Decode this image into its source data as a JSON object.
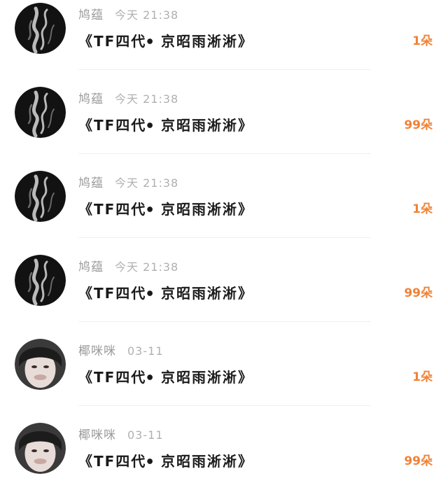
{
  "records": [
    {
      "user": "鸠蕴",
      "time": "今天 21:38",
      "message": "《TF四代ꔷ 京昭雨淅淅》",
      "gift": "1朵",
      "avatar": "smoke-avatar"
    },
    {
      "user": "鸠蕴",
      "time": "今天 21:38",
      "message": "《TF四代ꔷ 京昭雨淅淅》",
      "gift": "99朵",
      "avatar": "smoke-avatar"
    },
    {
      "user": "鸠蕴",
      "time": "今天 21:38",
      "message": "《TF四代ꔷ 京昭雨淅淅》",
      "gift": "1朵",
      "avatar": "smoke-avatar"
    },
    {
      "user": "鸠蕴",
      "time": "今天 21:38",
      "message": "《TF四代ꔷ 京昭雨淅淅》",
      "gift": "99朵",
      "avatar": "smoke-avatar"
    },
    {
      "user": "椰咪咪",
      "time": "03-11",
      "message": "《TF四代ꔷ 京昭雨淅淅》",
      "gift": "1朵",
      "avatar": "face-avatar"
    },
    {
      "user": "椰咪咪",
      "time": "03-11",
      "message": "《TF四代ꔷ 京昭雨淅淅》",
      "gift": "99朵",
      "avatar": "face-avatar"
    }
  ],
  "colors": {
    "gift": "#f08236",
    "name": "#9a9a9a",
    "time": "#b0b0b0",
    "message": "#1a1a1a",
    "divider": "#f0f0f0"
  }
}
